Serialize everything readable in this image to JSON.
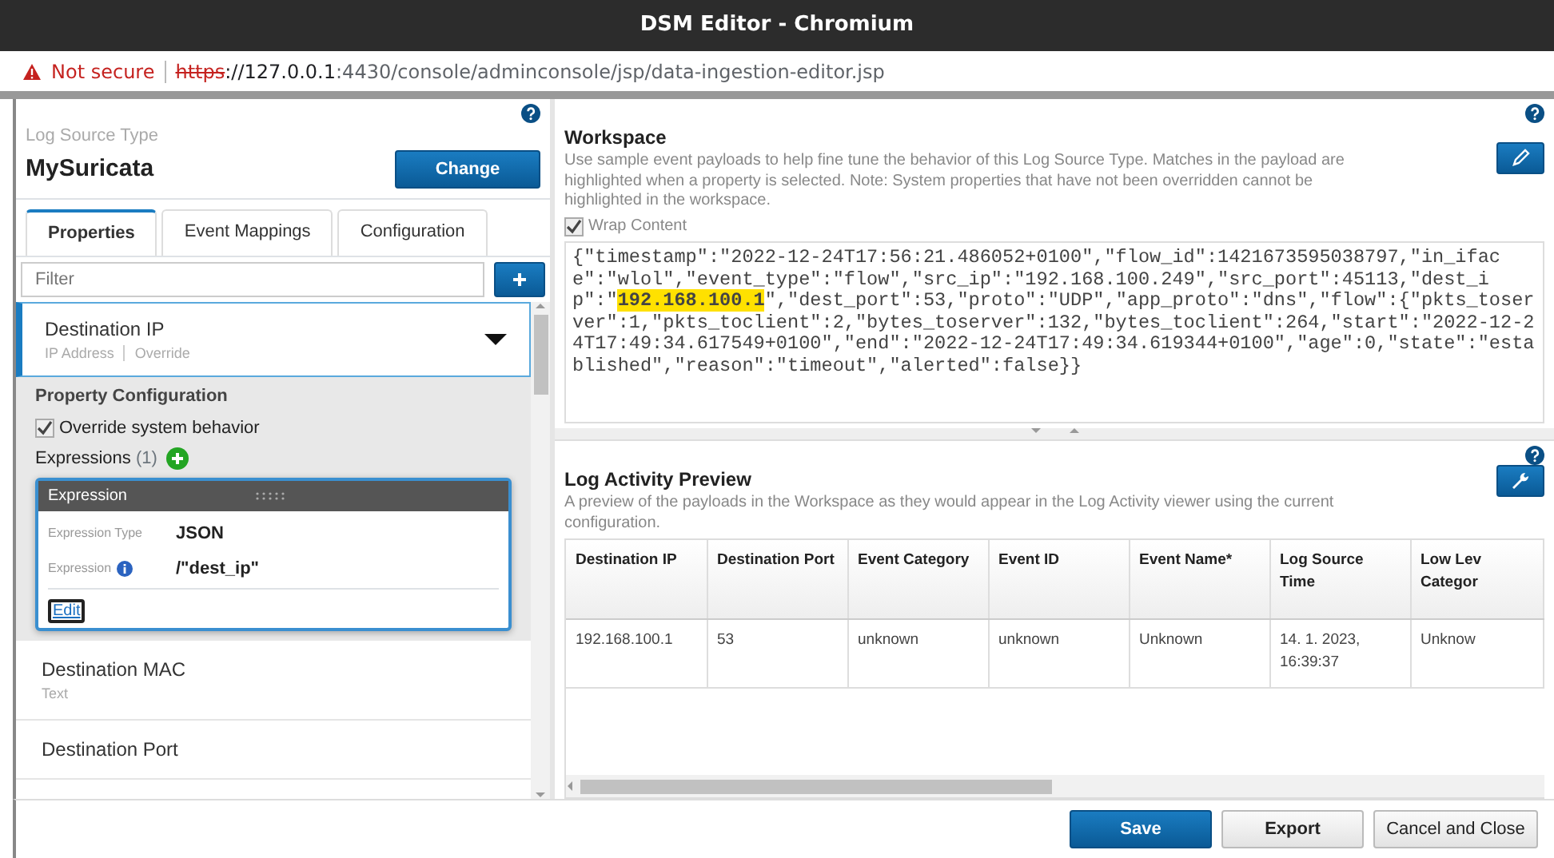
{
  "window": {
    "title": "DSM Editor - Chromium"
  },
  "address_bar": {
    "security": "Not secure",
    "scheme": "https",
    "host": "://127.0.0.1",
    "path": ":4430/console/adminconsole/jsp/data-ingestion-editor.jsp"
  },
  "log_source": {
    "label": "Log Source Type",
    "name": "MySuricata",
    "button": "Change"
  },
  "tabs": [
    {
      "label": "Properties",
      "selected": true
    },
    {
      "label": "Event Mappings",
      "selected": false
    },
    {
      "label": "Configuration",
      "selected": false
    }
  ],
  "filter": {
    "placeholder": "Filter"
  },
  "properties": [
    {
      "name": "Destination IP",
      "type": "IP Address",
      "override": "Override",
      "selected": true,
      "expanded": true
    },
    {
      "name": "Destination MAC",
      "type": "Text",
      "selected": false,
      "expanded": false
    },
    {
      "name": "Destination Port",
      "selected": false,
      "expanded": false
    }
  ],
  "property_configuration": {
    "title": "Property Configuration",
    "override": {
      "label": "Override system behavior",
      "checked": true
    },
    "expressions_label": "Expressions",
    "expressions_count": "(1)",
    "expression": {
      "title": "Expression",
      "type_label": "Expression Type",
      "type_value": "JSON",
      "expression_label": "Expression",
      "expression_value": "/\"dest_ip\"",
      "edit": "Edit"
    }
  },
  "workspace": {
    "title": "Workspace",
    "description": "Use sample event payloads to help fine tune the behavior of this Log Source Type. Matches in the payload are highlighted when a property is selected. Note: System properties that have not been overridden cannot be highlighted in the workspace.",
    "wrap": {
      "label": "Wrap Content",
      "checked": true
    },
    "payload": {
      "before": "{\"timestamp\":\"2022-12-24T17:56:21.486052+0100\",\"flow_id\":1421673595038797,\"in_iface\":\"wlol\",\"event_type\":\"flow\",\"src_ip\":\"192.168.100.249\",\"src_port\":45113,\"dest_ip\":\"",
      "highlight": "192.168.100.1",
      "after": "\",\"dest_port\":53,\"proto\":\"UDP\",\"app_proto\":\"dns\",\"flow\":{\"pkts_toserver\":1,\"pkts_toclient\":2,\"bytes_toserver\":132,\"bytes_toclient\":264,\"start\":\"2022-12-24T17:49:34.617549+0100\",\"end\":\"2022-12-24T17:49:34.619344+0100\",\"age\":0,\"state\":\"established\",\"reason\":\"timeout\",\"alerted\":false}}"
    }
  },
  "preview": {
    "title": "Log Activity Preview",
    "description": "A preview of the payloads in the Workspace as they would appear in the Log Activity viewer using the current configuration.",
    "table": {
      "columns": [
        "Destination IP",
        "Destination Port",
        "Event Category",
        "Event ID",
        "Event Name*",
        "Log Source Time",
        "Low Lev Categor"
      ],
      "rows": [
        [
          "192.168.100.1",
          "53",
          "unknown",
          "unknown",
          "Unknown",
          "14. 1. 2023, 16:39:37",
          "Unknow"
        ]
      ]
    }
  },
  "footer": {
    "buttons": [
      {
        "label": "Save",
        "kind": "primary"
      },
      {
        "label": "Export",
        "kind": "bold"
      },
      {
        "label": "Cancel and Close",
        "kind": "plain"
      }
    ]
  }
}
